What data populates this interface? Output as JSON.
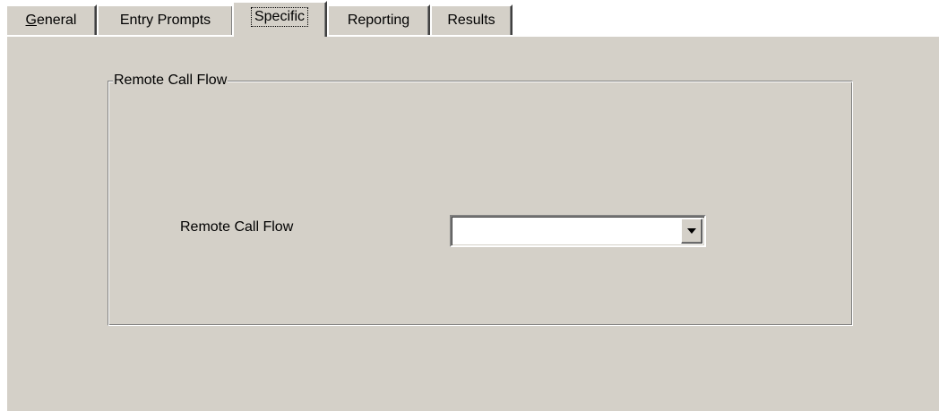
{
  "tabs": [
    {
      "label_accel": "G",
      "label_rest": "eneral",
      "active": false
    },
    {
      "label": "Entry Prompts",
      "active": false
    },
    {
      "label": "Specific",
      "active": true
    },
    {
      "label": "Reporting",
      "active": false
    },
    {
      "label": "Results",
      "active": false
    }
  ],
  "group": {
    "title": "Remote Call Flow"
  },
  "field": {
    "label": "Remote Call Flow",
    "value": ""
  },
  "icons": {
    "dropdown": "chevron-down-icon"
  },
  "colors": {
    "face": "#d4d0c8",
    "highlight": "#ffffff",
    "shadow": "#808080",
    "dark_shadow": "#404040",
    "field_bg": "#ffffff"
  }
}
